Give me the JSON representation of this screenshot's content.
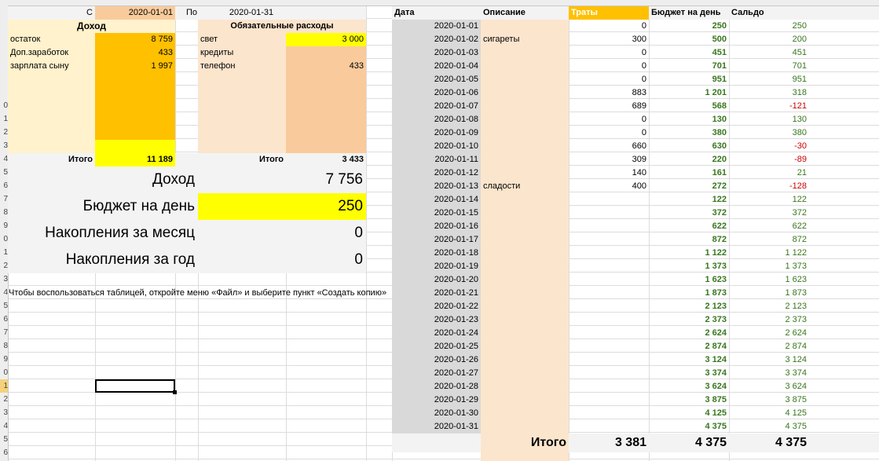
{
  "header": {
    "from_label": "С",
    "from_date": "2020-01-01",
    "to_label": "По",
    "to_date": "2020-01-31"
  },
  "income": {
    "title": "Доход",
    "items": [
      {
        "name": "остаток",
        "value": "8 759"
      },
      {
        "name": "Доп.заработок",
        "value": "433"
      },
      {
        "name": "зарплата сыну",
        "value": "1 997"
      }
    ],
    "total_label": "Итого",
    "total_value": "11 189"
  },
  "expenses": {
    "title": "Обязательные расходы",
    "items": [
      {
        "name": "свет",
        "value": "3 000"
      },
      {
        "name": "кредиты",
        "value": ""
      },
      {
        "name": "телефон",
        "value": "433"
      }
    ],
    "total_label": "Итого",
    "total_value": "3 433"
  },
  "summary": [
    {
      "label": "Доход",
      "value": "7 756"
    },
    {
      "label": "Бюджет на день",
      "value": "250"
    },
    {
      "label": "Накопления за месяц",
      "value": "0"
    },
    {
      "label": "Накопления за год",
      "value": "0"
    }
  ],
  "hint": "Чтобы воспользоваться таблицей, откройте меню «Файл» и выберите пункт «Создать копию»",
  "daily_table": {
    "headers": {
      "date": "Дата",
      "description": "Описание",
      "spent": "Траты",
      "budget": "Бюджет на день",
      "balance": "Сальдо"
    },
    "rows": [
      {
        "date": "2020-01-01",
        "description": "",
        "spent": "0",
        "budget": "250",
        "balance": "250"
      },
      {
        "date": "2020-01-02",
        "description": "сигареты",
        "spent": "300",
        "budget": "500",
        "balance": "200"
      },
      {
        "date": "2020-01-03",
        "description": "",
        "spent": "0",
        "budget": "451",
        "balance": "451"
      },
      {
        "date": "2020-01-04",
        "description": "",
        "spent": "0",
        "budget": "701",
        "balance": "701"
      },
      {
        "date": "2020-01-05",
        "description": "",
        "spent": "0",
        "budget": "951",
        "balance": "951"
      },
      {
        "date": "2020-01-06",
        "description": "",
        "spent": "883",
        "budget": "1 201",
        "balance": "318"
      },
      {
        "date": "2020-01-07",
        "description": "",
        "spent": "689",
        "budget": "568",
        "balance": "-121"
      },
      {
        "date": "2020-01-08",
        "description": "",
        "spent": "0",
        "budget": "130",
        "balance": "130"
      },
      {
        "date": "2020-01-09",
        "description": "",
        "spent": "0",
        "budget": "380",
        "balance": "380"
      },
      {
        "date": "2020-01-10",
        "description": "",
        "spent": "660",
        "budget": "630",
        "balance": "-30"
      },
      {
        "date": "2020-01-11",
        "description": "",
        "spent": "309",
        "budget": "220",
        "balance": "-89"
      },
      {
        "date": "2020-01-12",
        "description": "",
        "spent": "140",
        "budget": "161",
        "balance": "21"
      },
      {
        "date": "2020-01-13",
        "description": "сладости",
        "spent": "400",
        "budget": "272",
        "balance": "-128"
      },
      {
        "date": "2020-01-14",
        "description": "",
        "spent": "",
        "budget": "122",
        "balance": "122"
      },
      {
        "date": "2020-01-15",
        "description": "",
        "spent": "",
        "budget": "372",
        "balance": "372"
      },
      {
        "date": "2020-01-16",
        "description": "",
        "spent": "",
        "budget": "622",
        "balance": "622"
      },
      {
        "date": "2020-01-17",
        "description": "",
        "spent": "",
        "budget": "872",
        "balance": "872"
      },
      {
        "date": "2020-01-18",
        "description": "",
        "spent": "",
        "budget": "1 122",
        "balance": "1 122"
      },
      {
        "date": "2020-01-19",
        "description": "",
        "spent": "",
        "budget": "1 373",
        "balance": "1 373"
      },
      {
        "date": "2020-01-20",
        "description": "",
        "spent": "",
        "budget": "1 623",
        "balance": "1 623"
      },
      {
        "date": "2020-01-21",
        "description": "",
        "spent": "",
        "budget": "1 873",
        "balance": "1 873"
      },
      {
        "date": "2020-01-22",
        "description": "",
        "spent": "",
        "budget": "2 123",
        "balance": "2 123"
      },
      {
        "date": "2020-01-23",
        "description": "",
        "spent": "",
        "budget": "2 373",
        "balance": "2 373"
      },
      {
        "date": "2020-01-24",
        "description": "",
        "spent": "",
        "budget": "2 624",
        "balance": "2 624"
      },
      {
        "date": "2020-01-25",
        "description": "",
        "spent": "",
        "budget": "2 874",
        "balance": "2 874"
      },
      {
        "date": "2020-01-26",
        "description": "",
        "spent": "",
        "budget": "3 124",
        "balance": "3 124"
      },
      {
        "date": "2020-01-27",
        "description": "",
        "spent": "",
        "budget": "3 374",
        "balance": "3 374"
      },
      {
        "date": "2020-01-28",
        "description": "",
        "spent": "",
        "budget": "3 624",
        "balance": "3 624"
      },
      {
        "date": "2020-01-29",
        "description": "",
        "spent": "",
        "budget": "3 875",
        "balance": "3 875"
      },
      {
        "date": "2020-01-30",
        "description": "",
        "spent": "",
        "budget": "4 125",
        "balance": "4 125"
      },
      {
        "date": "2020-01-31",
        "description": "",
        "spent": "",
        "budget": "4 375",
        "balance": "4 375"
      }
    ],
    "total": {
      "label": "Итого",
      "spent": "3 381",
      "budget": "4 375",
      "balance": "4 375"
    }
  },
  "row_numbers": [
    "",
    "",
    "",
    "",
    "",
    "",
    "",
    "0",
    "1",
    "2",
    "3",
    "4",
    "5",
    "6",
    "7",
    "8",
    "9",
    "0",
    "1",
    "2",
    "3",
    "4",
    "5",
    "6",
    "7",
    "8",
    "9",
    "0",
    "1",
    "2",
    "3",
    "4",
    "5",
    "6"
  ],
  "colors": {
    "yellow": "#ffff00",
    "orange": "#ffc000",
    "header_orange": "#ffc000",
    "light_yellow": "#fff2cc",
    "peach": "#fce5cd",
    "salmon": "#f9cb9c",
    "gray_panel": "#f3f3f3",
    "date_gray": "#d9d9d9",
    "green_text": "#38761d",
    "red_text": "#cc0000"
  }
}
